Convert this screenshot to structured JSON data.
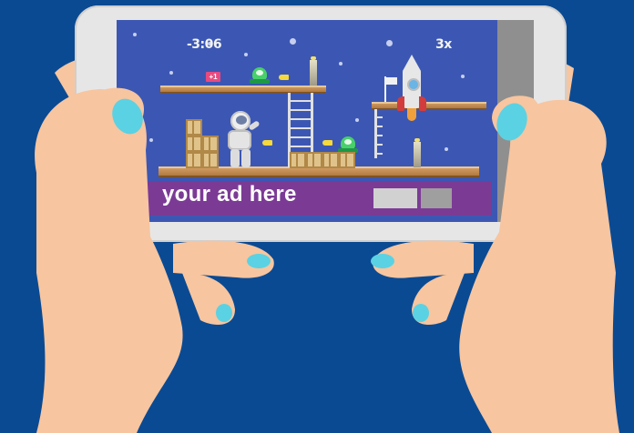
{
  "hud": {
    "timer": "-3:06",
    "lives": "3x"
  },
  "bonus_badge": "+1",
  "ad": {
    "text": "your ad here"
  },
  "icons": [
    "astronaut",
    "alien",
    "rocket",
    "ladder",
    "crate",
    "flag",
    "star"
  ],
  "colors": {
    "background": "#0a4a93",
    "sky": "#3c57b3",
    "ad_banner": "#7b3b95",
    "skin": "#f7c59f",
    "nails": "#5ad2e3",
    "platform": "#c88d50",
    "alien": "#48d06a"
  }
}
